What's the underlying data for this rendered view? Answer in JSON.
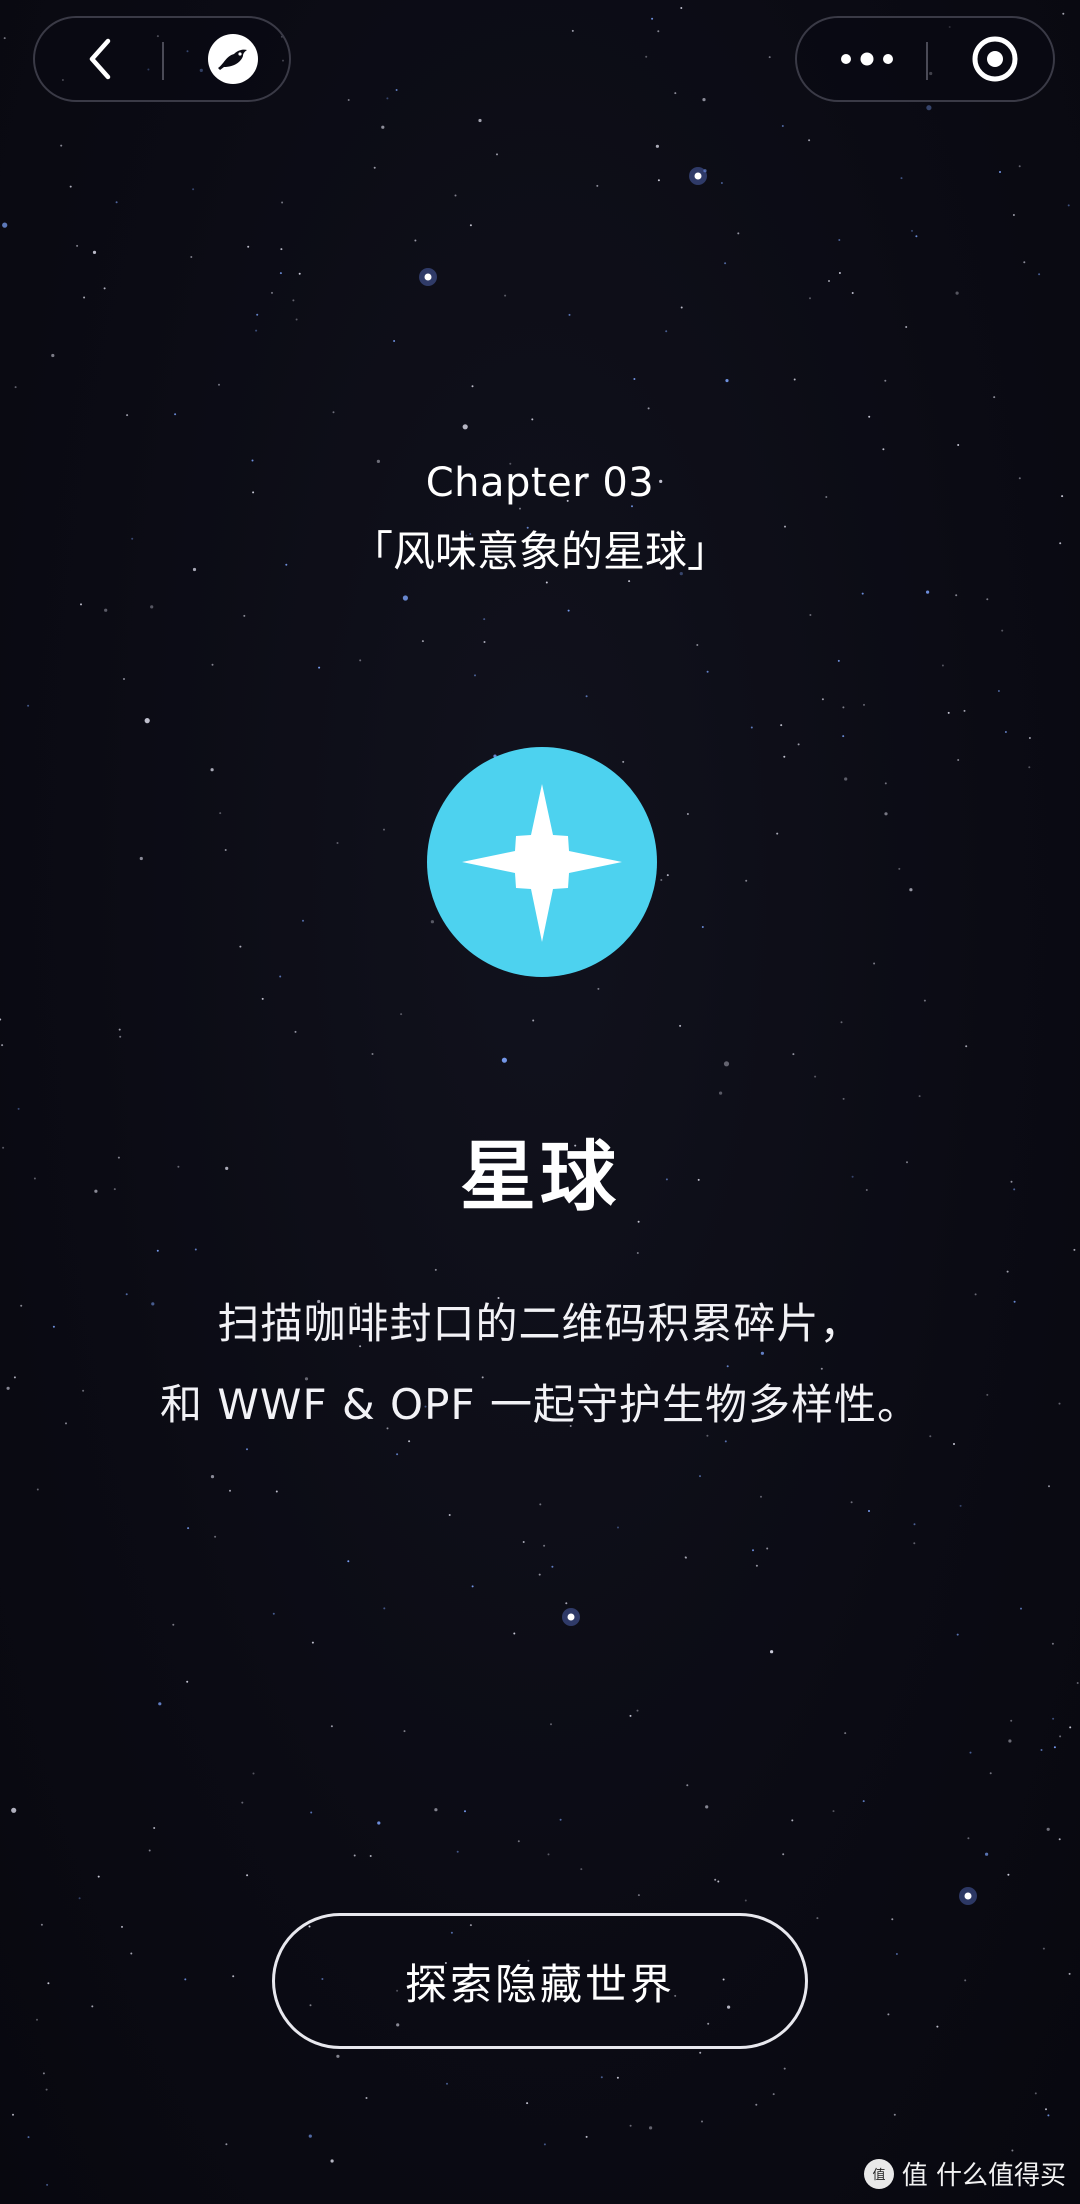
{
  "nav": {
    "back_icon": "chevron-left-icon",
    "brand_icon": "bird-logo-icon",
    "more_icon": "more-dots-icon",
    "close_icon": "target-close-icon"
  },
  "chapter": {
    "number": "Chapter 03",
    "subtitle": "「风味意象的星球」"
  },
  "badge": {
    "icon": "compass-star-icon",
    "color": "#4dd2ef"
  },
  "main": {
    "title": "星球",
    "desc_line1": "扫描咖啡封口的二维码积累碎片，",
    "desc_line2": "和 WWF & OPF 一起守护生物多样性。"
  },
  "cta": {
    "label": "探索隐藏世界"
  },
  "watermark": {
    "text": "值 什么值得买"
  },
  "colors": {
    "background": "#0b0b14",
    "accent": "#4dd2ef",
    "text": "#ffffff"
  }
}
